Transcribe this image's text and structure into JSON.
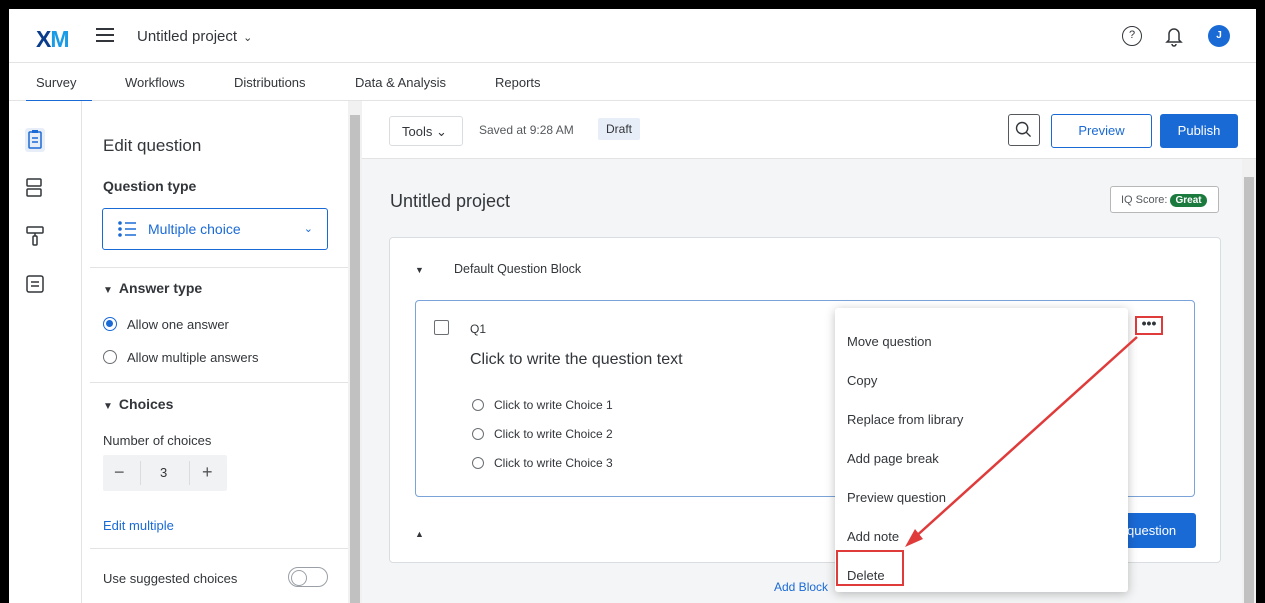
{
  "header": {
    "logo": "XM",
    "project_title": "Untitled project",
    "avatar_initial": "J"
  },
  "tabs": [
    {
      "label": "Survey",
      "active": true
    },
    {
      "label": "Workflows"
    },
    {
      "label": "Distributions"
    },
    {
      "label": "Data & Analysis"
    },
    {
      "label": "Reports"
    }
  ],
  "edit_panel": {
    "title": "Edit question",
    "question_type_label": "Question type",
    "question_type_value": "Multiple choice",
    "answer_type_label": "Answer type",
    "answer_options": [
      "Allow one answer",
      "Allow multiple answers"
    ],
    "choices_label": "Choices",
    "number_of_choices_label": "Number of choices",
    "number_of_choices": "3",
    "edit_multiple": "Edit multiple",
    "use_suggested": "Use suggested choices"
  },
  "toolbar": {
    "tools": "Tools",
    "saved": "Saved at 9:28 AM",
    "draft": "Draft",
    "preview": "Preview",
    "publish": "Publish"
  },
  "survey": {
    "title": "Untitled project",
    "iq_score_label": "IQ Score:",
    "iq_score_value": "Great",
    "block_title": "Default Question Block",
    "question_number": "Q1",
    "question_text": "Click to write the question text",
    "choices": [
      "Click to write Choice 1",
      "Click to write Choice 2",
      "Click to write Choice 3"
    ],
    "add_question": "question",
    "add_block": "Add Block"
  },
  "context_menu": {
    "items": [
      "Move question",
      "Copy",
      "Replace from library",
      "Add page break",
      "Preview question",
      "Add note",
      "Delete"
    ]
  },
  "colors": {
    "accent": "#1a6ad6",
    "highlight": "#e03b3b",
    "great_badge": "#1b7a3d"
  }
}
